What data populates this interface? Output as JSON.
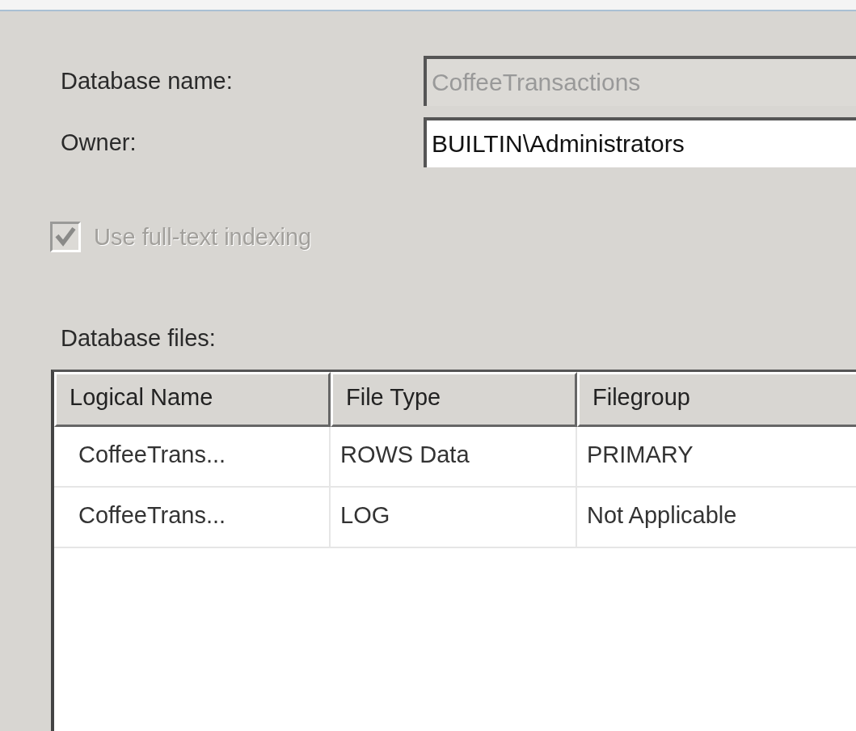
{
  "form": {
    "database_name": {
      "label": "Database name:",
      "value": "CoffeeTransactions",
      "disabled": true
    },
    "owner": {
      "label": "Owner:",
      "value": "BUILTIN\\Administrators",
      "disabled": false
    },
    "full_text_indexing": {
      "label": "Use full-text indexing",
      "checked": true,
      "disabled": true
    }
  },
  "database_files": {
    "label": "Database files:",
    "columns": [
      "Logical Name",
      "File Type",
      "Filegroup"
    ],
    "rows": [
      [
        "CoffeeTrans...",
        "ROWS Data",
        "PRIMARY"
      ],
      [
        "CoffeeTrans...",
        "LOG",
        "Not Applicable"
      ]
    ]
  }
}
